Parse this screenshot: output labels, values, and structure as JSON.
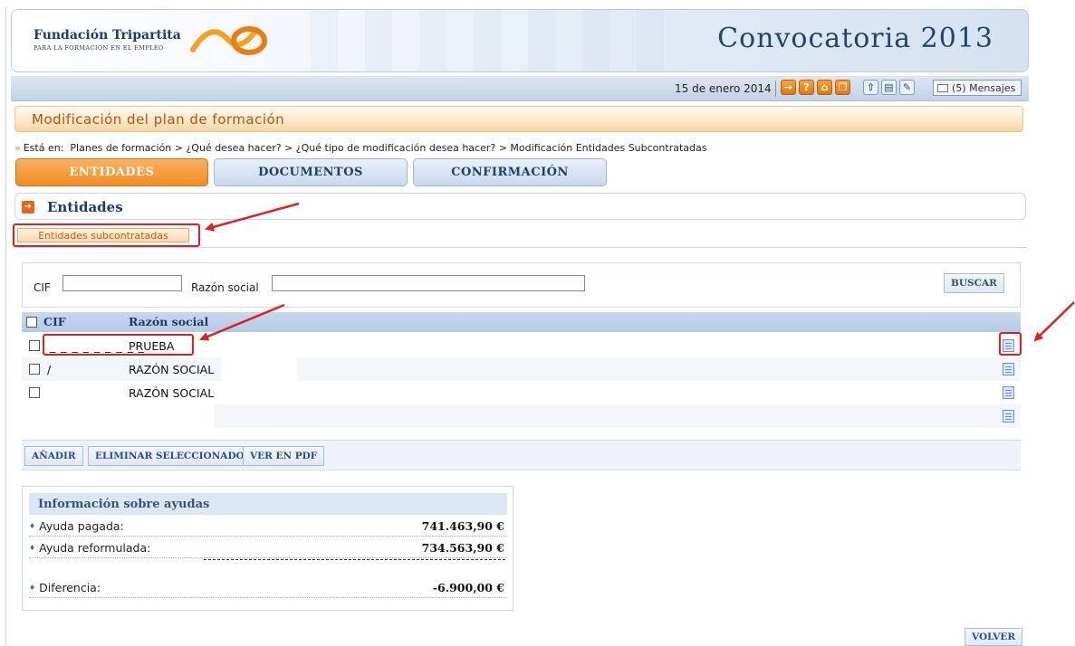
{
  "header": {
    "logo_line1": "Fundación Tripartita",
    "logo_line2": "PARA LA FORMACIÓN EN EL EMPLEO",
    "title": "Convocatoria 2013"
  },
  "toolbar": {
    "date": "15 de enero 2014",
    "messages_label": "(5) Mensajes"
  },
  "page_title": "Modificación del plan de formación",
  "breadcrumb": {
    "prefix": "Está en:",
    "path": "Planes de formación > ¿Qué desea hacer? > ¿Qué tipo de modificación desea hacer? > Modificación Entidades Subcontratadas"
  },
  "tabs": [
    {
      "label": "ENTIDADES",
      "active": true
    },
    {
      "label": "DOCUMENTOS",
      "active": false
    },
    {
      "label": "CONFIRMACIÓN",
      "active": false
    }
  ],
  "section": {
    "title": "Entidades",
    "subtab_label": "Entidades subcontratadas"
  },
  "search": {
    "cif_label": "CIF",
    "cif_value": "",
    "razon_label": "Razón social",
    "razon_value": "",
    "button": "BUSCAR"
  },
  "table": {
    "columns": [
      "CIF",
      "Razón social"
    ],
    "rows": [
      {
        "cif": "_ _ _ _ _ _ _ _ _",
        "razon": "PRUEBA"
      },
      {
        "cif": "/",
        "razon": "RAZÓN SOCIAL"
      },
      {
        "cif": "",
        "razon": "RAZÓN SOCIAL"
      },
      {
        "cif": "",
        "razon": ""
      }
    ]
  },
  "actions": {
    "add": "AÑADIR",
    "delete_selected": "ELIMINAR SELECCIONADOS",
    "view_pdf": "VER EN PDF"
  },
  "info": {
    "title": "Información sobre ayudas",
    "paid_label": "Ayuda pagada:",
    "paid_value": "741.463,90 €",
    "reformulated_label": "Ayuda reformulada:",
    "reformulated_value": "734.563,90 €",
    "difference_label": "Diferencia:",
    "difference_value": "-6.900,00 €"
  },
  "footer": {
    "back_button": "VOLVER"
  },
  "colors": {
    "accent_orange": "#f28c22",
    "primary_blue": "#1f3a66",
    "annotation_red": "#e02020"
  }
}
